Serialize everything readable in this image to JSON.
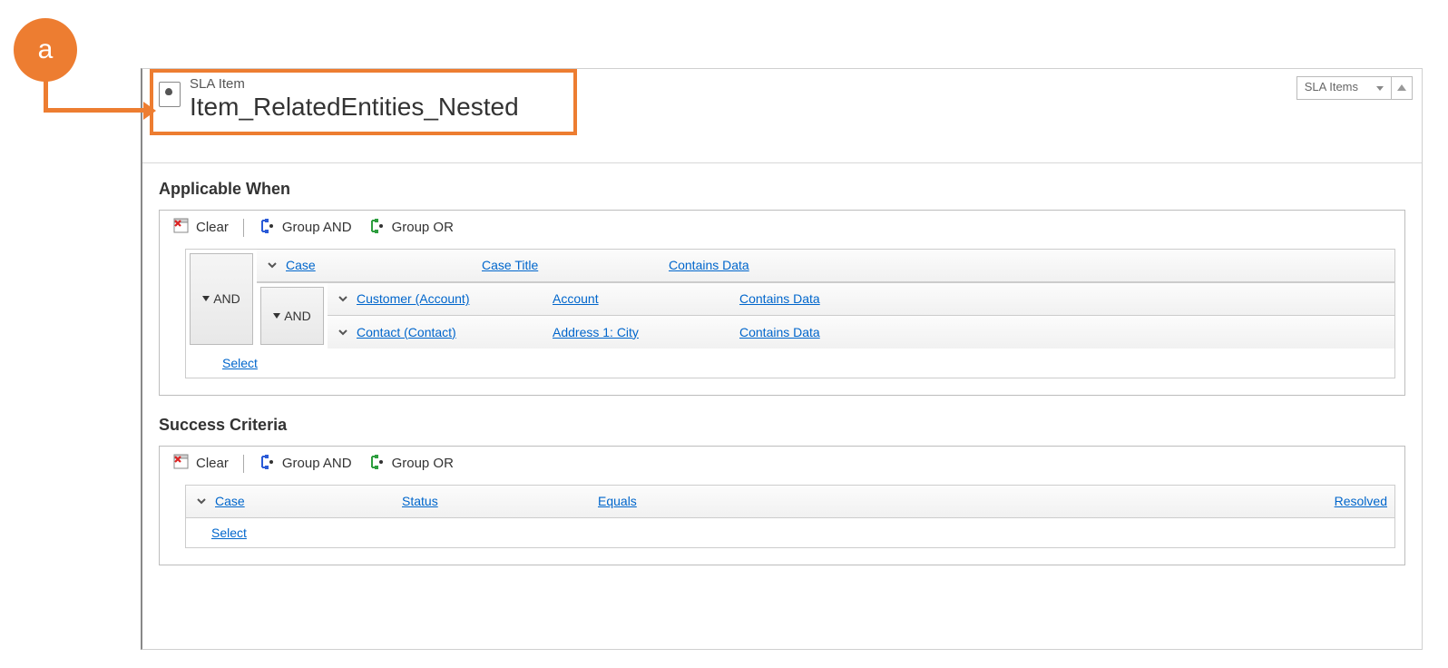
{
  "callout": {
    "label": "a"
  },
  "header": {
    "entity_label": "SLA Item",
    "record_title": "Item_RelatedEntities_Nested",
    "nav_dropdown": "SLA Items"
  },
  "toolbar": {
    "clear": "Clear",
    "group_and": "Group AND",
    "group_or": "Group OR"
  },
  "applicable": {
    "title": "Applicable When",
    "outer_op": "AND",
    "row1": {
      "entity": "Case",
      "attr": "Case Title",
      "op": "Contains Data"
    },
    "nested_op": "AND",
    "row2": {
      "entity": "Customer (Account)",
      "attr": "Account",
      "op": "Contains Data"
    },
    "row3": {
      "entity": "Contact (Contact)",
      "attr": "Address 1: City",
      "op": "Contains Data"
    },
    "select": "Select"
  },
  "success": {
    "title": "Success Criteria",
    "row1": {
      "entity": "Case",
      "attr": "Status",
      "op": "Equals",
      "val": "Resolved"
    },
    "select": "Select"
  }
}
